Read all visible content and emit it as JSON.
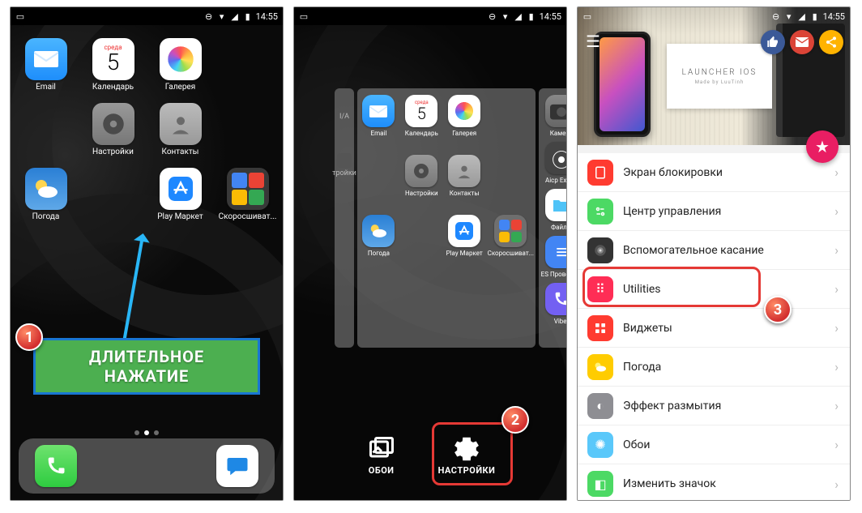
{
  "status": {
    "time": "14:55"
  },
  "phone1": {
    "apps": {
      "email": "Email",
      "calendar": "Календарь",
      "cal_dow": "среда",
      "cal_day": "5",
      "gallery": "Галерея",
      "settings": "Настройки",
      "contacts": "Контакты",
      "weather": "Погода",
      "play": "Play Маркет",
      "folder": "Скоросшиват..."
    },
    "label_line1": "ДЛИТЕЛЬНОЕ",
    "label_line2": "НАЖАТИЕ",
    "badge": "1"
  },
  "phone2": {
    "left_items": [
      "I/A",
      "тройки"
    ],
    "center": {
      "email": "Email",
      "calendar": "Календарь",
      "cal_dow": "среда",
      "cal_day": "5",
      "gallery": "Галерея",
      "settings": "Настройки",
      "contacts": "Контакты",
      "weather": "Погода",
      "play": "Play Маркет",
      "folder": "Скоросшиват..."
    },
    "right": {
      "camera": "Камера",
      "aicp": "Aicp Extras",
      "files": "Файлы",
      "es": "ES Проводн...",
      "viber": "Viber"
    },
    "opt_wall": "ОБОИ",
    "opt_settings": "НАСТРОЙКИ",
    "badge": "2"
  },
  "phone3": {
    "header_title": "LAUNCHER IOS",
    "header_sub": "Made by LuuTinh",
    "rows": {
      "lock": "Экран блокировки",
      "cc": "Центр управления",
      "assist": "Вспомогательное касание",
      "util": "Utilities",
      "widg": "Виджеты",
      "weather": "Погода",
      "blur": "Эффект размытия",
      "wall": "Обои",
      "icon": "Изменить значок"
    },
    "badge": "3"
  }
}
